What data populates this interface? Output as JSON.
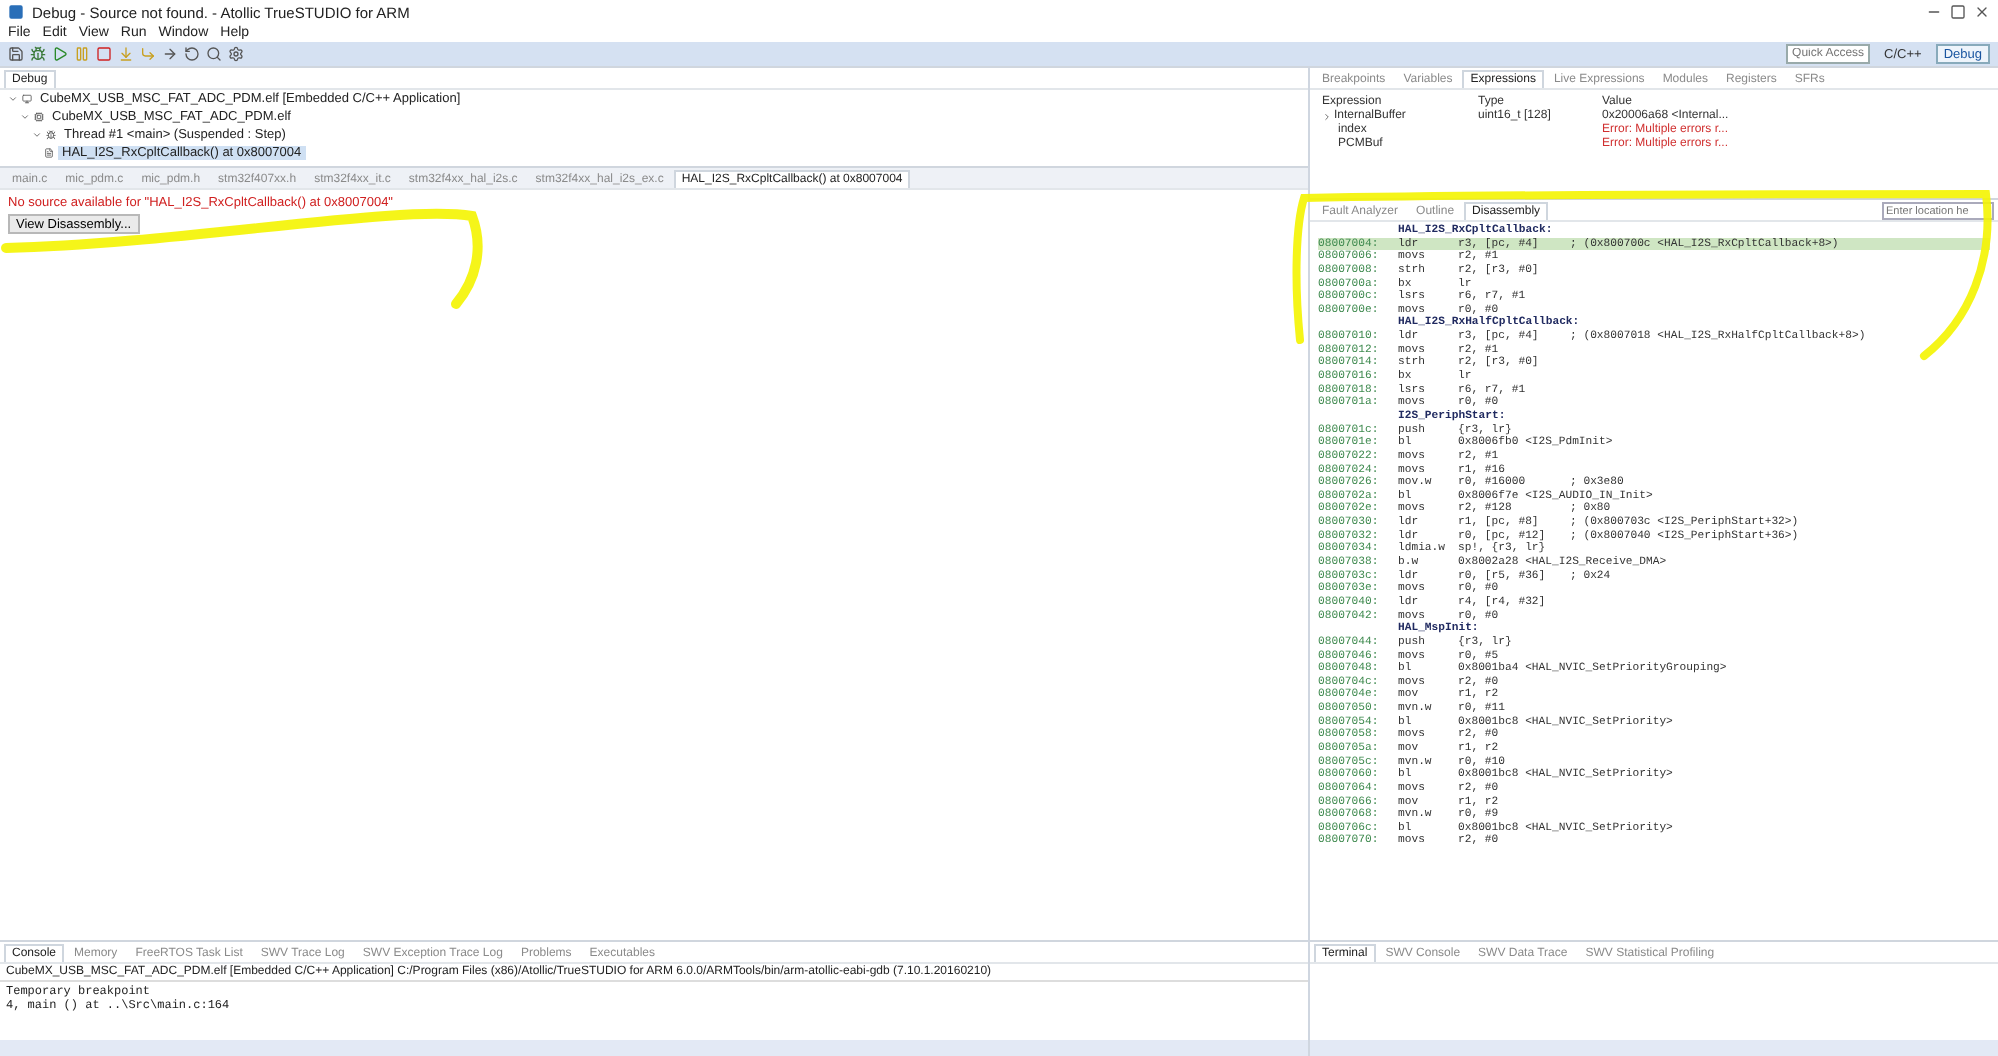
{
  "window": {
    "title": "Debug - Source not found. - Atollic TrueSTUDIO for ARM"
  },
  "menu": [
    "File",
    "Edit",
    "View",
    "Run",
    "Window",
    "Help"
  ],
  "toolbar": {
    "quick_access": {
      "placeholder": "Quick Access"
    },
    "perspectives": [
      {
        "label": "C/C++",
        "selected": false
      },
      {
        "label": "Debug",
        "selected": true
      }
    ]
  },
  "debug_view": {
    "title": "Debug",
    "tree": [
      {
        "label": "CubeMX_USB_MSC_FAT_ADC_PDM.elf [Embedded C/C++ Application]",
        "kind": "application",
        "expanded": true,
        "selected": false,
        "children": [
          {
            "label": "CubeMX_USB_MSC_FAT_ADC_PDM.elf",
            "kind": "elf",
            "expanded": true,
            "selected": false,
            "children": [
              {
                "label": "Thread #1 <main> (Suspended : Step)",
                "kind": "thread",
                "expanded": true,
                "selected": false,
                "children": [
                  {
                    "label": "HAL_I2S_RxCpltCallback() at 0x8007004",
                    "kind": "frame",
                    "selected": true
                  }
                ]
              }
            ]
          }
        ]
      }
    ]
  },
  "editor": {
    "tabs": [
      {
        "label": "main.c",
        "selected": false
      },
      {
        "label": "mic_pdm.c",
        "selected": false
      },
      {
        "label": "mic_pdm.h",
        "selected": false
      },
      {
        "label": "stm32f407xx.h",
        "selected": false
      },
      {
        "label": "stm32f4xx_it.c",
        "selected": false
      },
      {
        "label": "stm32f4xx_hal_i2s.c",
        "selected": false
      },
      {
        "label": "stm32f4xx_hal_i2s_ex.c",
        "selected": false
      },
      {
        "label": "HAL_I2S_RxCpltCallback() at 0x8007004",
        "selected": true
      }
    ],
    "message": "No source available for \"HAL_I2S_RxCpltCallback() at 0x8007004\"",
    "button": "View Disassembly..."
  },
  "expressions_view": {
    "tabs": [
      {
        "label": "Breakpoints",
        "selected": false
      },
      {
        "label": "Variables",
        "selected": false
      },
      {
        "label": "Expressions",
        "selected": true
      },
      {
        "label": "Live Expressions",
        "selected": false
      },
      {
        "label": "Modules",
        "selected": false
      },
      {
        "label": "Registers",
        "selected": false
      },
      {
        "label": "SFRs",
        "selected": false
      }
    ],
    "columns": [
      "Expression",
      "Type",
      "Value"
    ],
    "rows": [
      {
        "expression": "InternalBuffer",
        "type": "uint16_t [128]",
        "value": "0x20006a68 <Internal...",
        "expandable": true,
        "error": false
      },
      {
        "expression": "index",
        "value": "Error: Multiple errors r...",
        "expandable": false,
        "error": true
      },
      {
        "expression": "PCMBuf",
        "value": "Error: Multiple errors r...",
        "expandable": false,
        "error": true
      }
    ]
  },
  "disassembly_view": {
    "tabs": [
      {
        "label": "Fault Analyzer",
        "selected": false
      },
      {
        "label": "Outline",
        "selected": false
      },
      {
        "label": "Disassembly",
        "selected": true
      }
    ],
    "location": {
      "placeholder": "Enter location he"
    },
    "lines": [
      {
        "kind": "label",
        "text": "HAL_I2S_RxCpltCallback:"
      },
      {
        "kind": "instruction",
        "address": "08007004:",
        "mnemonic": "ldr",
        "operands": "r3, [pc, #4]",
        "comment": "; (0x800700c <HAL_I2S_RxCpltCallback+8>)",
        "current": true
      },
      {
        "kind": "instruction",
        "address": "08007006:",
        "mnemonic": "movs",
        "operands": "r2, #1",
        "current": false
      },
      {
        "kind": "instruction",
        "address": "08007008:",
        "mnemonic": "strh",
        "operands": "r2, [r3, #0]",
        "current": false
      },
      {
        "kind": "instruction",
        "address": "0800700a:",
        "mnemonic": "bx",
        "operands": "lr",
        "current": false
      },
      {
        "kind": "instruction",
        "address": "0800700c:",
        "mnemonic": "lsrs",
        "operands": "r6, r7, #1",
        "current": false
      },
      {
        "kind": "instruction",
        "address": "0800700e:",
        "mnemonic": "movs",
        "operands": "r0, #0",
        "current": false
      },
      {
        "kind": "label",
        "text": "HAL_I2S_RxHalfCpltCallback:"
      },
      {
        "kind": "instruction",
        "address": "08007010:",
        "mnemonic": "ldr",
        "operands": "r3, [pc, #4]",
        "comment": "; (0x8007018 <HAL_I2S_RxHalfCpltCallback+8>)",
        "current": false
      },
      {
        "kind": "instruction",
        "address": "08007012:",
        "mnemonic": "movs",
        "operands": "r2, #1",
        "current": false
      },
      {
        "kind": "instruction",
        "address": "08007014:",
        "mnemonic": "strh",
        "operands": "r2, [r3, #0]",
        "current": false
      },
      {
        "kind": "instruction",
        "address": "08007016:",
        "mnemonic": "bx",
        "operands": "lr",
        "current": false
      },
      {
        "kind": "instruction",
        "address": "08007018:",
        "mnemonic": "lsrs",
        "operands": "r6, r7, #1",
        "current": false
      },
      {
        "kind": "instruction",
        "address": "0800701a:",
        "mnemonic": "movs",
        "operands": "r0, #0",
        "current": false
      },
      {
        "kind": "label",
        "text": "I2S_PeriphStart:"
      },
      {
        "kind": "instruction",
        "address": "0800701c:",
        "mnemonic": "push",
        "operands": "{r3, lr}",
        "current": false
      },
      {
        "kind": "instruction",
        "address": "0800701e:",
        "mnemonic": "bl",
        "operands": "0x8006fb0 <I2S_PdmInit>",
        "current": false
      },
      {
        "kind": "instruction",
        "address": "08007022:",
        "mnemonic": "movs",
        "operands": "r2, #1",
        "current": false
      },
      {
        "kind": "instruction",
        "address": "08007024:",
        "mnemonic": "movs",
        "operands": "r1, #16",
        "current": false
      },
      {
        "kind": "instruction",
        "address": "08007026:",
        "mnemonic": "mov.w",
        "operands": "r0, #16000",
        "comment": "; 0x3e80",
        "current": false
      },
      {
        "kind": "instruction",
        "address": "0800702a:",
        "mnemonic": "bl",
        "operands": "0x8006f7e <I2S_AUDIO_IN_Init>",
        "current": false
      },
      {
        "kind": "instruction",
        "address": "0800702e:",
        "mnemonic": "movs",
        "operands": "r2, #128",
        "comment": "; 0x80",
        "current": false
      },
      {
        "kind": "instruction",
        "address": "08007030:",
        "mnemonic": "ldr",
        "operands": "r1, [pc, #8]",
        "comment": "; (0x800703c <I2S_PeriphStart+32>)",
        "current": false
      },
      {
        "kind": "instruction",
        "address": "08007032:",
        "mnemonic": "ldr",
        "operands": "r0, [pc, #12]",
        "comment": "; (0x8007040 <I2S_PeriphStart+36>)",
        "current": false
      },
      {
        "kind": "instruction",
        "address": "08007034:",
        "mnemonic": "ldmia.w",
        "operands": "sp!, {r3, lr}",
        "current": false
      },
      {
        "kind": "instruction",
        "address": "08007038:",
        "mnemonic": "b.w",
        "operands": "0x8002a28 <HAL_I2S_Receive_DMA>",
        "current": false
      },
      {
        "kind": "instruction",
        "address": "0800703c:",
        "mnemonic": "ldr",
        "operands": "r0, [r5, #36]",
        "comment": "; 0x24",
        "current": false
      },
      {
        "kind": "instruction",
        "address": "0800703e:",
        "mnemonic": "movs",
        "operands": "r0, #0",
        "current": false
      },
      {
        "kind": "instruction",
        "address": "08007040:",
        "mnemonic": "ldr",
        "operands": "r4, [r4, #32]",
        "current": false
      },
      {
        "kind": "instruction",
        "address": "08007042:",
        "mnemonic": "movs",
        "operands": "r0, #0",
        "current": false
      },
      {
        "kind": "label",
        "text": "HAL_MspInit:"
      },
      {
        "kind": "instruction",
        "address": "08007044:",
        "mnemonic": "push",
        "operands": "{r3, lr}",
        "current": false
      },
      {
        "kind": "instruction",
        "address": "08007046:",
        "mnemonic": "movs",
        "operands": "r0, #5",
        "current": false
      },
      {
        "kind": "instruction",
        "address": "08007048:",
        "mnemonic": "bl",
        "operands": "0x8001ba4 <HAL_NVIC_SetPriorityGrouping>",
        "current": false
      },
      {
        "kind": "instruction",
        "address": "0800704c:",
        "mnemonic": "movs",
        "operands": "r2, #0",
        "current": false
      },
      {
        "kind": "instruction",
        "address": "0800704e:",
        "mnemonic": "mov",
        "operands": "r1, r2",
        "current": false
      },
      {
        "kind": "instruction",
        "address": "08007050:",
        "mnemonic": "mvn.w",
        "operands": "r0, #11",
        "current": false
      },
      {
        "kind": "instruction",
        "address": "08007054:",
        "mnemonic": "bl",
        "operands": "0x8001bc8 <HAL_NVIC_SetPriority>",
        "current": false
      },
      {
        "kind": "instruction",
        "address": "08007058:",
        "mnemonic": "movs",
        "operands": "r2, #0",
        "current": false
      },
      {
        "kind": "instruction",
        "address": "0800705a:",
        "mnemonic": "mov",
        "operands": "r1, r2",
        "current": false
      },
      {
        "kind": "instruction",
        "address": "0800705c:",
        "mnemonic": "mvn.w",
        "operands": "r0, #10",
        "current": false
      },
      {
        "kind": "instruction",
        "address": "08007060:",
        "mnemonic": "bl",
        "operands": "0x8001bc8 <HAL_NVIC_SetPriority>",
        "current": false
      },
      {
        "kind": "instruction",
        "address": "08007064:",
        "mnemonic": "movs",
        "operands": "r2, #0",
        "current": false
      },
      {
        "kind": "instruction",
        "address": "08007066:",
        "mnemonic": "mov",
        "operands": "r1, r2",
        "current": false
      },
      {
        "kind": "instruction",
        "address": "08007068:",
        "mnemonic": "mvn.w",
        "operands": "r0, #9",
        "current": false
      },
      {
        "kind": "instruction",
        "address": "0800706c:",
        "mnemonic": "bl",
        "operands": "0x8001bc8 <HAL_NVIC_SetPriority>",
        "current": false
      },
      {
        "kind": "instruction",
        "address": "08007070:",
        "mnemonic": "movs",
        "operands": "r2, #0",
        "current": false
      }
    ]
  },
  "console_view": {
    "tabs": [
      {
        "label": "Console",
        "selected": true
      },
      {
        "label": "Memory",
        "selected": false
      },
      {
        "label": "FreeRTOS Task List",
        "selected": false
      },
      {
        "label": "SWV Trace Log",
        "selected": false
      },
      {
        "label": "SWV Exception Trace Log",
        "selected": false
      },
      {
        "label": "Problems",
        "selected": false
      },
      {
        "label": "Executables",
        "selected": false
      }
    ],
    "header": "CubeMX_USB_MSC_FAT_ADC_PDM.elf [Embedded C/C++ Application] C:/Program Files (x86)/Atollic/TrueSTUDIO for ARM 6.0.0/ARMTools/bin/arm-atollic-eabi-gdb (7.10.1.20160210)",
    "lines": [
      "Temporary breakpoint",
      "4, main () at ..\\Src\\main.c:164"
    ]
  },
  "terminal_view": {
    "tabs": [
      {
        "label": "Terminal",
        "selected": true
      },
      {
        "label": "SWV Console",
        "selected": false
      },
      {
        "label": "SWV Data Trace",
        "selected": false
      },
      {
        "label": "SWV Statistical Profiling",
        "selected": false
      }
    ]
  }
}
